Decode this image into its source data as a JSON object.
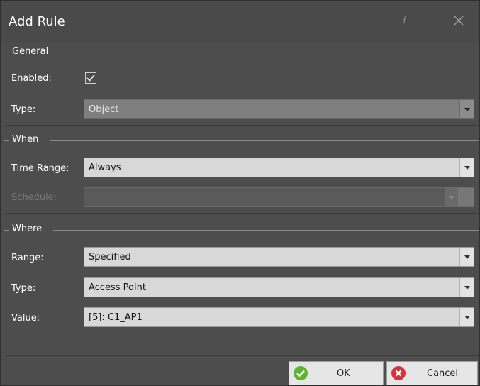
{
  "dialog": {
    "title": "Add Rule",
    "help_label": "?",
    "close_icon": "close-icon"
  },
  "general": {
    "header": "General",
    "enabled_label": "Enabled:",
    "enabled_checked": true,
    "type_label": "Type:",
    "type_value": "Object"
  },
  "when": {
    "header": "When",
    "time_range_label": "Time Range:",
    "time_range_value": "Always",
    "schedule_label": "Schedule:",
    "schedule_value": ""
  },
  "where": {
    "header": "Where",
    "range_label": "Range:",
    "range_value": "Specified",
    "type_label": "Type:",
    "type_value": "Access Point",
    "value_label": "Value:",
    "value_value": "[5]: C1_AP1"
  },
  "buttons": {
    "ok_label": "OK",
    "cancel_label": "Cancel",
    "ok_color": "#5bb531",
    "cancel_color": "#d9323a"
  }
}
